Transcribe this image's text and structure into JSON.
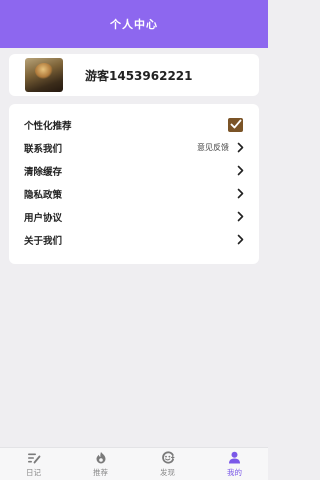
{
  "header": {
    "title": "个人中心"
  },
  "profile": {
    "username": "游客1453962221"
  },
  "settings": {
    "items": [
      {
        "label": "个性化推荐",
        "control": "checkbox",
        "checked": true
      },
      {
        "label": "联系我们",
        "hint": "意见反馈"
      },
      {
        "label": "清除缓存"
      },
      {
        "label": "隐私政策"
      },
      {
        "label": "用户协议"
      },
      {
        "label": "关于我们"
      }
    ]
  },
  "tabbar": {
    "tabs": [
      {
        "label": "日记",
        "icon": "diary-icon",
        "active": false
      },
      {
        "label": "推荐",
        "icon": "flame-icon",
        "active": false
      },
      {
        "label": "发现",
        "icon": "discover-icon",
        "active": false
      },
      {
        "label": "我的",
        "icon": "person-icon",
        "active": true
      }
    ]
  },
  "colors": {
    "accent": "#8d67ef",
    "tab_active": "#7a58e8",
    "checkbox": "#7b5427"
  }
}
